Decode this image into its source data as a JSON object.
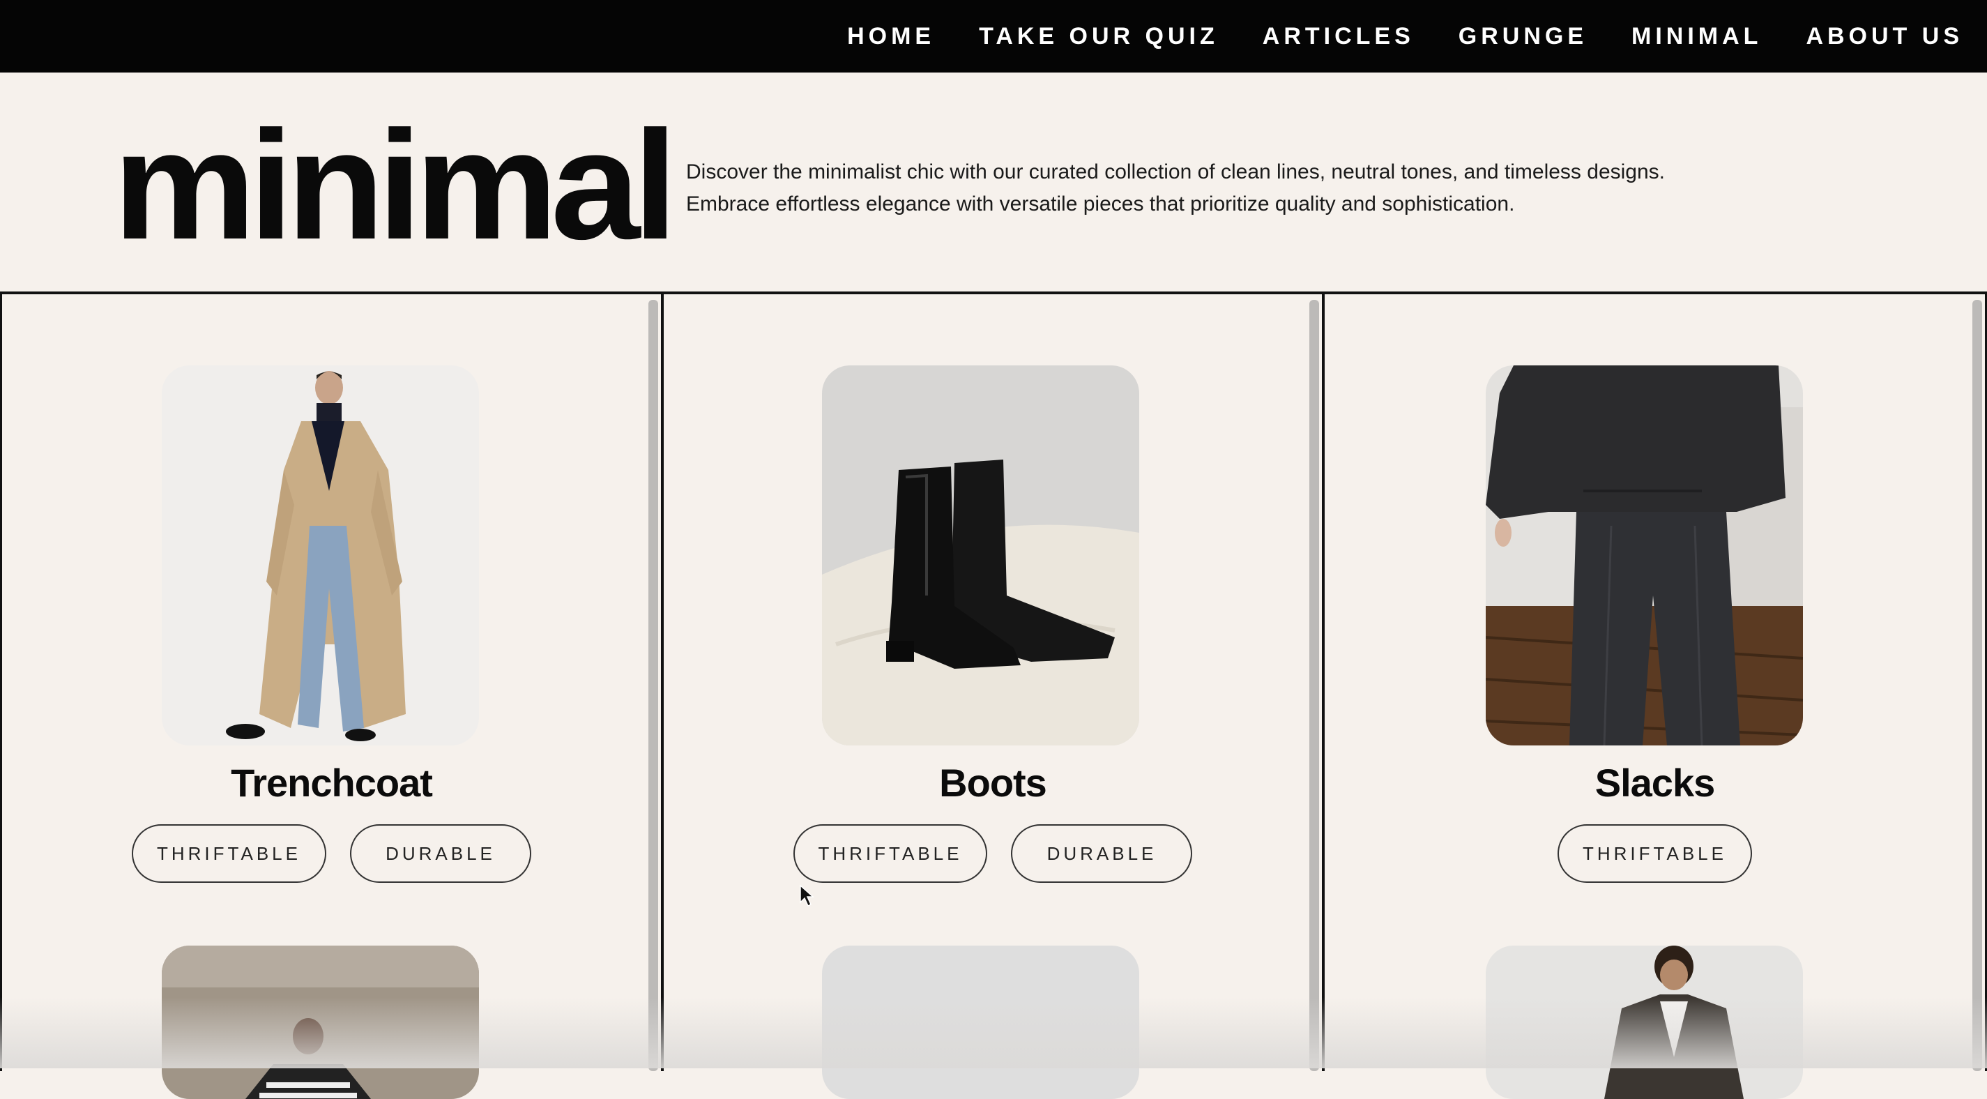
{
  "nav": {
    "items": [
      {
        "label": "HOME"
      },
      {
        "label": "TAKE OUR QUIZ"
      },
      {
        "label": "ARTICLES"
      },
      {
        "label": "GRUNGE"
      },
      {
        "label": "MINIMAL"
      },
      {
        "label": "ABOUT US"
      }
    ]
  },
  "header": {
    "title": "minimal",
    "description": "Discover the minimalist chic with our curated collection of clean lines, neutral tones, and timeless designs. Embrace effortless elegance with versatile pieces that prioritize quality and sophistication."
  },
  "products": [
    {
      "name": "Trenchcoat",
      "tags": [
        "THRIFTABLE",
        "DURABLE"
      ],
      "image": "trenchcoat-photo"
    },
    {
      "name": "Boots",
      "tags": [
        "THRIFTABLE",
        "DURABLE"
      ],
      "image": "boots-photo"
    },
    {
      "name": "Slacks",
      "tags": [
        "THRIFTABLE"
      ],
      "image": "slacks-photo"
    }
  ],
  "colors": {
    "nav_bg": "#050505",
    "page_bg": "#f6f1ec",
    "text": "#0b0b0b"
  }
}
